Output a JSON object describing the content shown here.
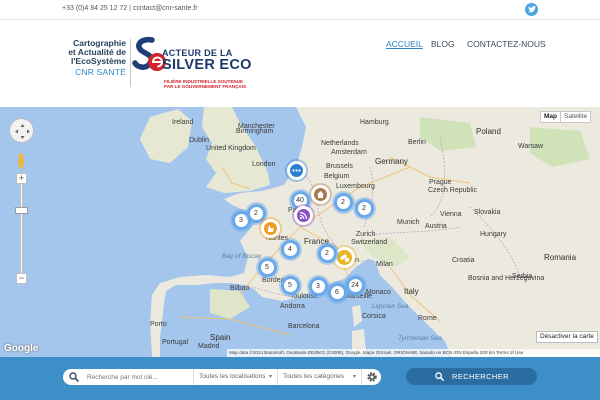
{
  "topbar": {
    "contact": "+33 (0)4 84 25 12 72 | ccntact@cnr-sante.fr",
    "twitter_icon": "twitter-icon"
  },
  "logo": {
    "line1": "Cartographie",
    "line2": "et Actualité de",
    "line3": "l'EcoSystème",
    "line4": "CNR SANTÉ",
    "badge_title_1": "ACTEUR DE LA",
    "badge_title_2": "SILVER ECO",
    "badge_sub_1": "FILIÈRE INDUSTRIELLE SOUTENUE",
    "badge_sub_2": "PAR LE GOUVERNEMENT FRANÇAIS"
  },
  "nav": {
    "items": [
      {
        "label": "ACCUEIL",
        "active": true
      },
      {
        "label": "BLOG",
        "active": false
      },
      {
        "label": "CONTACTEZ-NOUS",
        "active": false
      }
    ]
  },
  "map": {
    "type_buttons": [
      "Map",
      "Satellite"
    ],
    "labels": {
      "iceland": "Ireland",
      "dublin": "Dublin",
      "manchester": "Manchester",
      "birmingham": "Birmingham",
      "uk": "United Kingdom",
      "london": "London",
      "amsterdam": "Amsterdam",
      "netherlands": "Netherlands",
      "brussels": "Brussels",
      "belgium": "Belgium",
      "luxembourg": "Luxembourg",
      "germany": "Germany",
      "hamburg": "Hamburg",
      "berlin": "Berlin",
      "poland": "Poland",
      "warsaw": "Warsaw",
      "prague": "Prague",
      "czech": "Czech Republic",
      "slovakia": "Slovakia",
      "vienna": "Vienna",
      "austria": "Austria",
      "hungary": "Hungary",
      "munich": "Munich",
      "zurich": "Zurich",
      "switzerland": "Switzerland",
      "paris": "Paris",
      "france": "France",
      "nantes": "Nantes",
      "lyon": "Lyon",
      "bordeaux": "Bordeaux",
      "toulouse": "Toulouse",
      "marseille": "Marseille",
      "milan": "Milan",
      "croatia": "Croatia",
      "bosnia": "Bosnia and\nHerzegovina",
      "serbia": "Serbia",
      "romania": "Romania",
      "italy": "Italy",
      "rome": "Rome",
      "spain": "Spain",
      "madrid": "Madrid",
      "barcelona": "Barcelona",
      "portugal": "Portugal",
      "bilbao": "Bilbao",
      "andorra": "Andorra",
      "monaco": "Monaco",
      "corsica": "Corsica",
      "tyrrhenian": "Tyrrhenian Sea",
      "biscay": "Bay of Biscay",
      "ligurian": "Ligurian Sea",
      "porto": "Porto"
    },
    "clusters": [
      {
        "label": "",
        "kind": "blue",
        "icon": "dots"
      },
      {
        "label": "",
        "kind": "brown",
        "icon": "house"
      },
      {
        "label": "40",
        "kind": "plain"
      },
      {
        "label": "",
        "kind": "purple",
        "icon": "wifi"
      },
      {
        "label": "2",
        "kind": "plain"
      },
      {
        "label": "2",
        "kind": "plain"
      },
      {
        "label": "3",
        "kind": "plain"
      },
      {
        "label": "2",
        "kind": "plain"
      },
      {
        "label": "",
        "kind": "orange",
        "icon": "hand"
      },
      {
        "label": "4",
        "kind": "plain"
      },
      {
        "label": "5",
        "kind": "plain"
      },
      {
        "label": "",
        "kind": "yellow",
        "icon": "pills"
      },
      {
        "label": "2",
        "kind": "plain"
      },
      {
        "label": "5",
        "kind": "plain"
      },
      {
        "label": "3",
        "kind": "plain"
      },
      {
        "label": "6",
        "kind": "plain"
      },
      {
        "label": "24",
        "kind": "plain"
      }
    ],
    "disable_button": "Désactiver la carte",
    "google": "Google",
    "credits": "Map data ©2014 Basarsoft, GeoBasis-DE/BKG (©2009), Google, Mapa GISrael, ORION-ME, basado en BCN IGN España     200 km     Terms of Use"
  },
  "search": {
    "placeholder": "Recherche par mot clé...",
    "location_select": "Toutes les localisations",
    "category_select": "Toutes les catégories",
    "button": "RECHERCHER"
  },
  "colors": {
    "accent": "#2a86c9",
    "search_bar": "#3d8fc8",
    "search_button": "#2b6da1",
    "sea": "#a5c6ec",
    "land": "#eceadf"
  }
}
